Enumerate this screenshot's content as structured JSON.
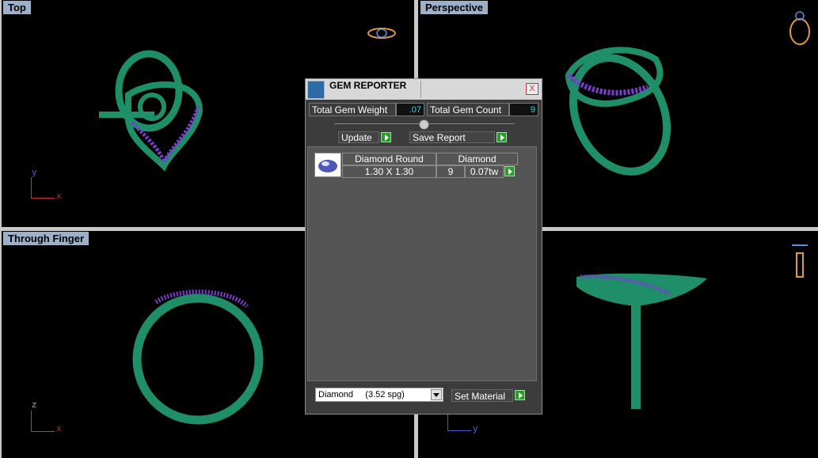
{
  "viewports": {
    "top": {
      "label": "Top",
      "axis": {
        "v": "y",
        "h": "x"
      }
    },
    "perspective": {
      "label": "Perspective"
    },
    "through_finger": {
      "label": "Through Finger",
      "axis": {
        "v": "z",
        "h": "x"
      }
    },
    "side": {
      "label": "",
      "axis": {
        "v": "",
        "h": "y"
      }
    }
  },
  "dialog": {
    "title": "GEM REPORTER",
    "close_symbol": "X",
    "total_weight_label": "Total Gem Weight",
    "total_weight_value": ".07",
    "total_count_label": "Total Gem Count",
    "total_count_value": "9",
    "update_label": "Update",
    "save_label": "Save Report",
    "gem": {
      "shape": "Diamond Round",
      "material": "Diamond",
      "size": "1.30 X 1.30",
      "count": "9",
      "weight": "0.07tw"
    },
    "material_select": "Diamond     (3.52 spg)",
    "set_material_label": "Set Material"
  },
  "colors": {
    "ring_green": "#1f8f6a",
    "gem_purple": "#7a3ccf",
    "viewport_label_bg": "#9db0c9",
    "accent_green": "#2c9a2c"
  }
}
